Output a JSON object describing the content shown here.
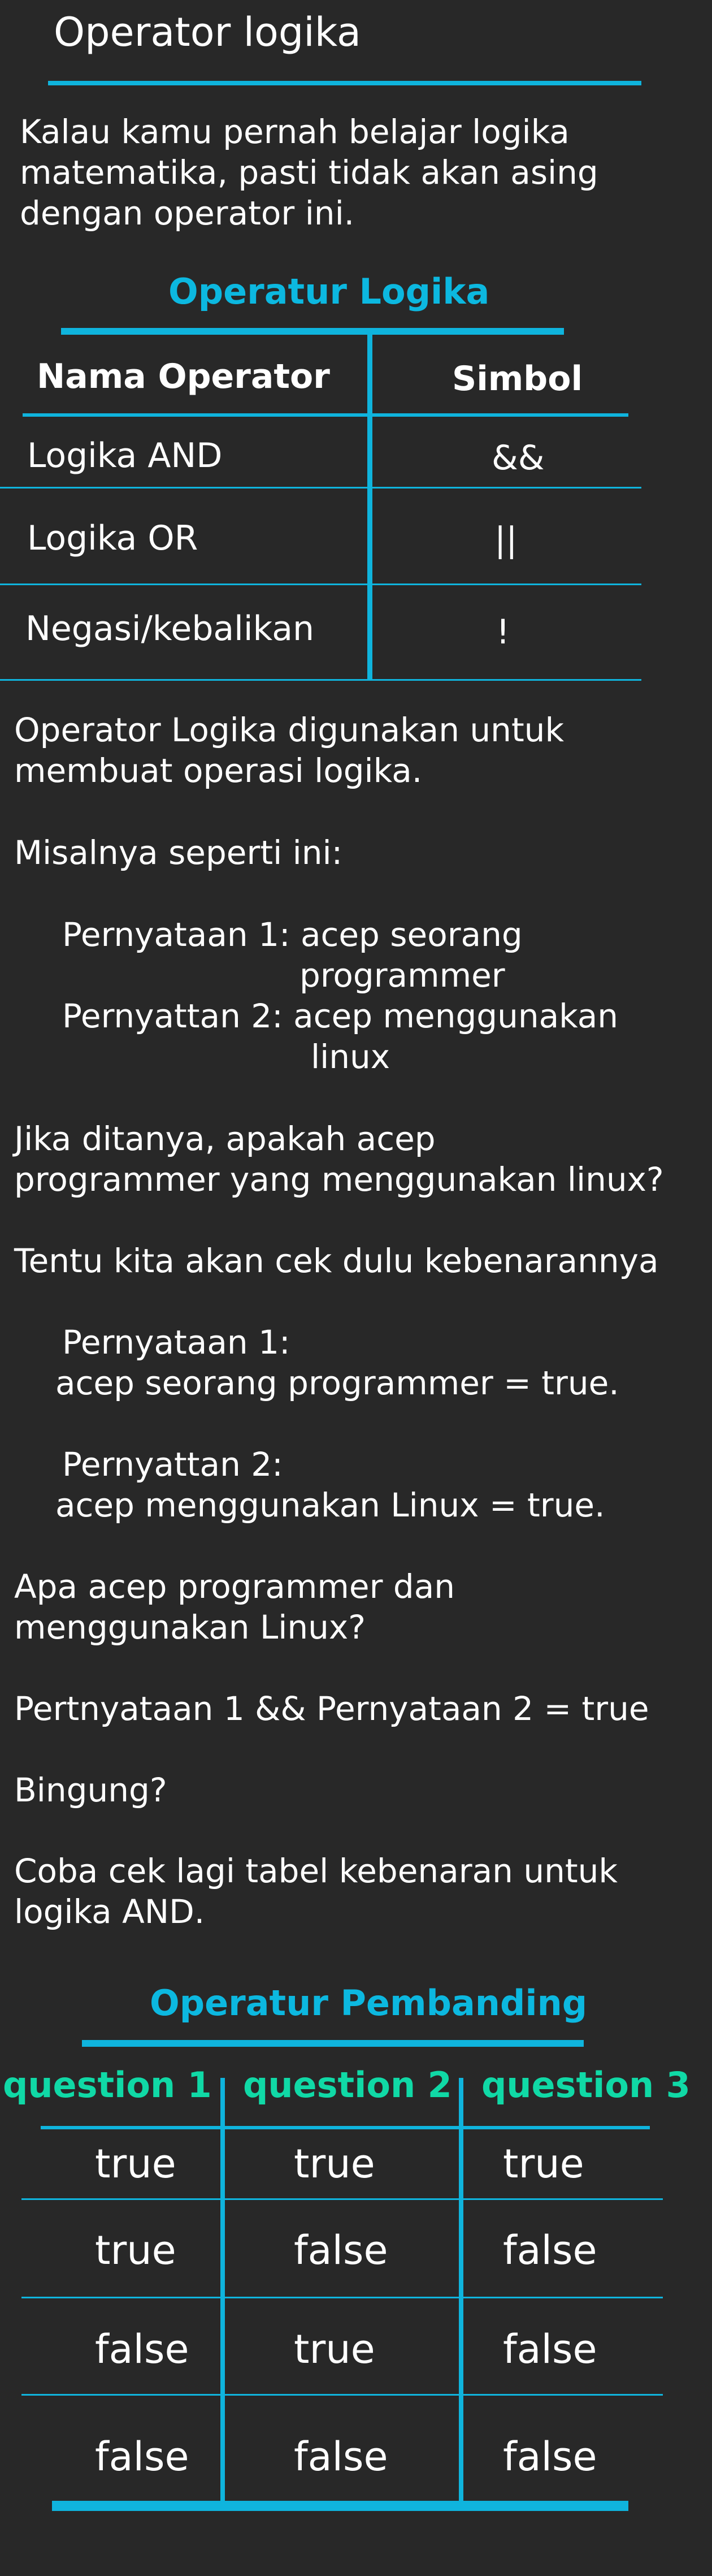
{
  "title": "Operator logika",
  "intro": [
    "Kalau kamu pernah belajar logika",
    "matematika, pasti tidak akan asing",
    "dengan operator ini."
  ],
  "table_logika": {
    "title": "Operatur Logika",
    "headers": [
      "Nama Operator",
      "Simbol"
    ],
    "rows": [
      [
        "Logika AND",
        "&&"
      ],
      [
        "Logika OR",
        "||"
      ],
      [
        "Negasi/kebalikan",
        "!"
      ]
    ]
  },
  "body_lines": [
    "Operator Logika digunakan untuk",
    "membuat operasi logika.",
    "Misalnya seperti ini:",
    "Pernyataan 1: acep seorang",
    "programmer",
    "Pernyattan 2: acep menggunakan",
    "linux",
    "Jika ditanya, apakah acep",
    "programmer yang menggunakan linux?",
    "Tentu kita akan cek dulu kebenarannya",
    "Pernyataan 1:",
    "acep seorang programmer = true.",
    "Pernyattan 2:",
    "acep menggunakan Linux = true.",
    "Apa acep programmer dan",
    "menggunakan Linux?",
    "Pertnyataan 1 && Pernyataan 2 = true",
    "Bingung?",
    "Coba cek lagi tabel kebenaran untuk",
    "logika AND."
  ],
  "table_pembanding": {
    "title": "Operatur Pembanding",
    "headers": [
      "question 1",
      "question 2",
      "question 3"
    ],
    "rows": [
      [
        "true",
        "true",
        "true"
      ],
      [
        "true",
        "false",
        "false"
      ],
      [
        "false",
        "true",
        "false"
      ],
      [
        "false",
        "false",
        "false"
      ]
    ]
  },
  "colors": {
    "background": "#282828",
    "accent_line": "#0fb4dd",
    "title_cyan": "#0cb8e0",
    "header_green": "#10d9a6",
    "text": "#ffffff"
  }
}
